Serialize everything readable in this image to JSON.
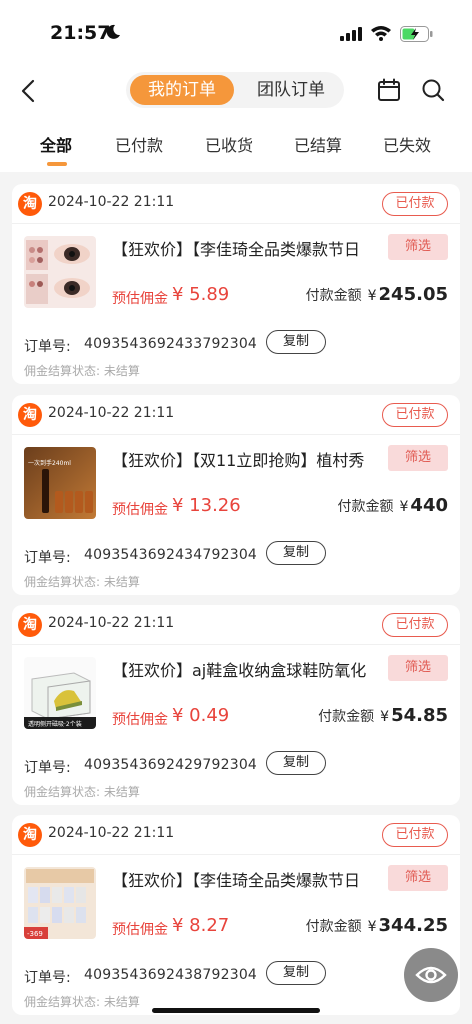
{
  "status_bar": {
    "time": "21:57"
  },
  "nav": {
    "tab_mine": "我的订单",
    "tab_team": "团队订单"
  },
  "filter_tabs": [
    "全部",
    "已付款",
    "已收货",
    "已结算",
    "已失效"
  ],
  "colors": {
    "accent": "#f5973b",
    "price_red": "#e8443c",
    "taobao": "#ff5a0a"
  },
  "labels": {
    "commission": "预估佣金",
    "payment": "付款金额",
    "order_no": "订单号:",
    "copy": "复制",
    "filter": "筛选",
    "currency": "¥",
    "settle_status": "佣金结算状态: 未结算",
    "taobao_logo": "淘"
  },
  "orders": [
    {
      "date": "2024-10-22 21:11",
      "status": "已付款",
      "title": "【狂欢价】【李佳琦全品类爆款节日",
      "commission": "¥ 5.89",
      "payment": "245.05",
      "order_no": "4093543692433792304",
      "thumb": "eyeshadow"
    },
    {
      "date": "2024-10-22 21:11",
      "status": "已付款",
      "title": "【狂欢价】【双11立即抢购】植村秀",
      "commission": "¥ 13.26",
      "payment": "440",
      "order_no": "4093543692434792304",
      "thumb": "serum",
      "thumb_text": "一次到手240ml"
    },
    {
      "date": "2024-10-22 21:11",
      "status": "已付款",
      "title": "【狂欢价】aj鞋盒收纳盒球鞋防氧化",
      "commission": "¥ 0.49",
      "payment": "54.85",
      "order_no": "4093543692429792304",
      "thumb": "shoebox",
      "thumb_text": "透明侧开磁吸·2个装"
    },
    {
      "date": "2024-10-22 21:11",
      "status": "已付款",
      "title": "【狂欢价】【李佳琦全品类爆款节日",
      "commission": "¥ 8.27",
      "payment": "344.25",
      "order_no": "4093543692438792304",
      "thumb": "skincare",
      "thumb_text": "-369"
    }
  ]
}
